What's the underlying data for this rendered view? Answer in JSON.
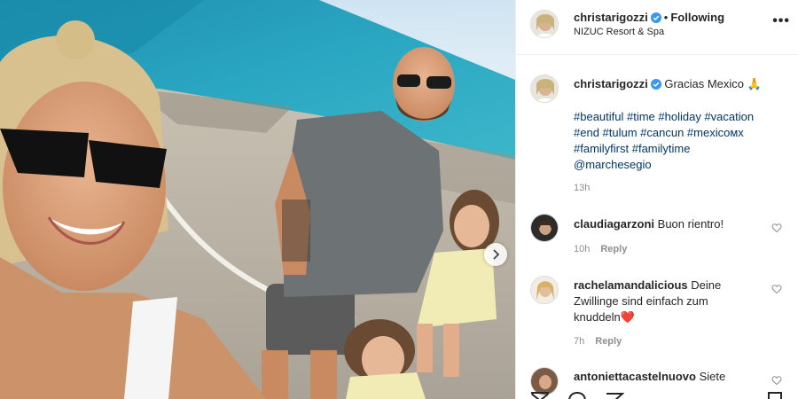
{
  "post": {
    "username": "christarigozzi",
    "separator": "•",
    "follow_state": "Following",
    "location": "NIZUC Resort & Spa"
  },
  "caption": {
    "username": "christarigozzi",
    "text": "Gracias Mexico 🙏",
    "hashtag_lines": [
      "#beautiful #time #holiday #vacation",
      "#end #tulum #cancun #mexicoмх",
      "#familyfirst #familytime",
      "@marchesegio"
    ],
    "time": "13h"
  },
  "comments": [
    {
      "username": "claudiagarzoni",
      "lines": [
        "Buon rientro!"
      ],
      "time": "10h",
      "reply_label": "Reply"
    },
    {
      "username": "rachelamandalicious",
      "lines": [
        "Deine",
        "Zwillinge sind einfach zum",
        "knuddeln❤️"
      ],
      "time": "7h",
      "reply_label": "Reply"
    },
    {
      "username": "antonietta castelnuovo",
      "lines": [
        "Siete"
      ],
      "time": "",
      "reply_label": ""
    }
  ],
  "icons": {
    "more": "more-options-icon",
    "verified": "verified-badge-icon",
    "heart": "heart-icon",
    "next": "chevron-right-icon"
  },
  "colors": {
    "verified": "#3897f0",
    "link": "#00376b",
    "muted": "#8e8e8e"
  }
}
